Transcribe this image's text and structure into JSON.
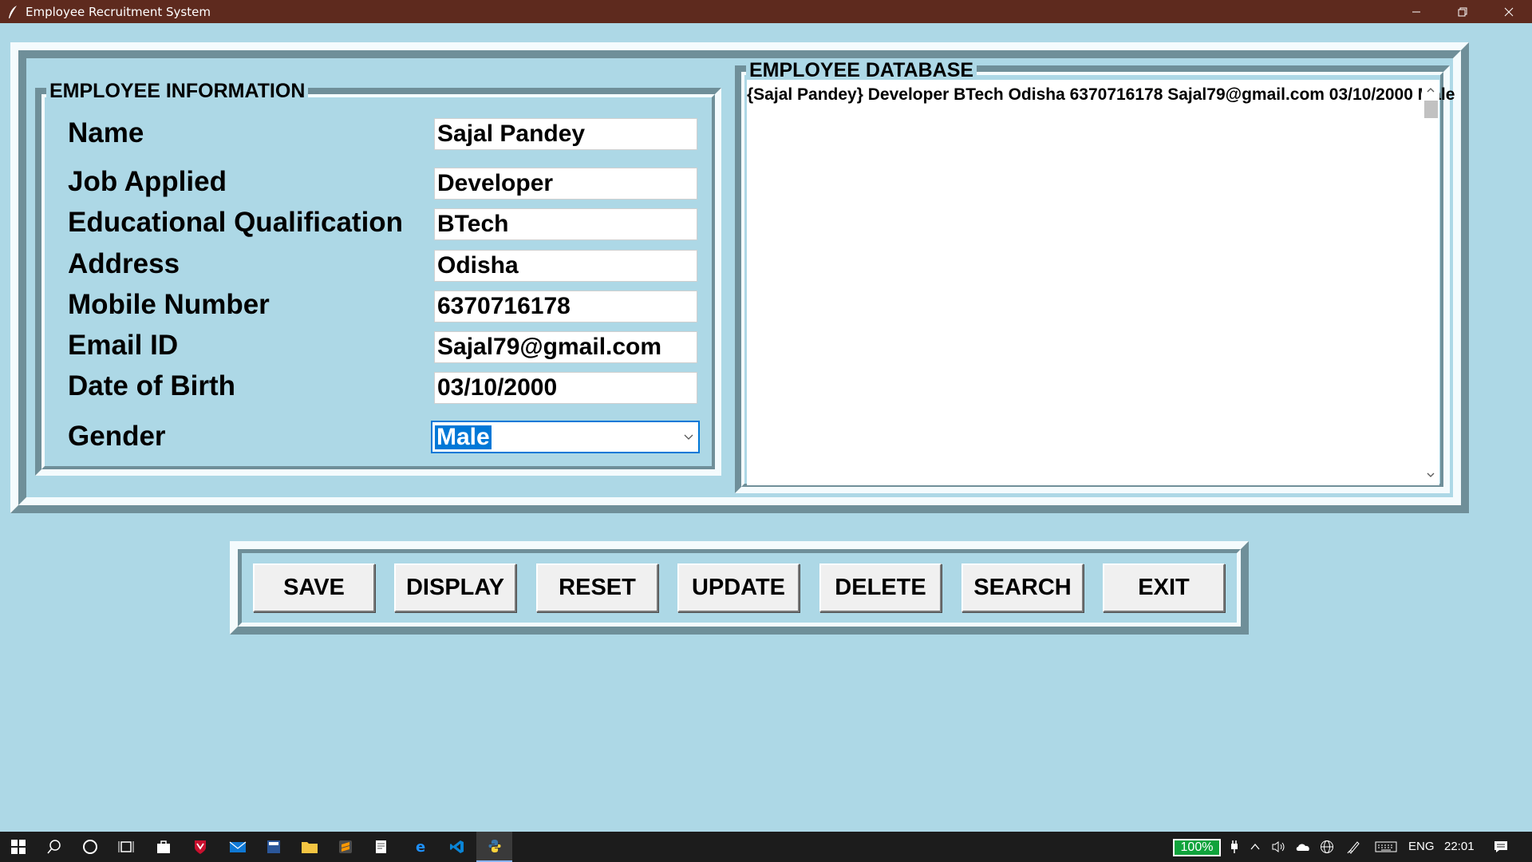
{
  "window": {
    "title": "Employee Recruitment System"
  },
  "info_section": {
    "title": "EMPLOYEE INFORMATION",
    "fields": [
      {
        "label": "Name",
        "value": "Sajal Pandey"
      },
      {
        "label": "Job Applied",
        "value": "Developer"
      },
      {
        "label": "Educational Qualification",
        "value": "BTech"
      },
      {
        "label": "Address",
        "value": "Odisha"
      },
      {
        "label": "Mobile Number",
        "value": "6370716178"
      },
      {
        "label": "Email ID",
        "value": "Sajal79@gmail.com"
      },
      {
        "label": "Date of Birth",
        "value": "03/10/2000"
      }
    ],
    "gender": {
      "label": "Gender",
      "value": "Male"
    }
  },
  "database_section": {
    "title": "EMPLOYEE DATABASE",
    "rows": [
      "{Sajal Pandey} Developer BTech Odisha 6370716178 Sajal79@gmail.com 03/10/2000 Male"
    ]
  },
  "buttons": {
    "save": "SAVE",
    "display": "DISPLAY",
    "reset": "RESET",
    "update": "UPDATE",
    "delete": "DELETE",
    "search": "SEARCH",
    "exit": "EXIT"
  },
  "taskbar": {
    "battery": "100%",
    "language": "ENG",
    "time": "22:01",
    "icons": [
      "windows-start-icon",
      "search-icon",
      "cortana-icon",
      "task-view-icon",
      "store-icon",
      "mcafee-icon",
      "mail-icon",
      "calculator-icon",
      "file-explorer-icon",
      "sublime-text-icon",
      "notepad-icon",
      "edge-icon",
      "vscode-icon",
      "python-icon"
    ]
  },
  "colors": {
    "background": "#add8e6",
    "titlebar": "#5e2a1e",
    "selection": "#0078d7",
    "battery": "#10a33c"
  }
}
